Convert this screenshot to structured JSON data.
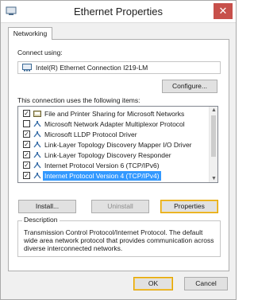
{
  "window": {
    "title": "Ethernet Properties",
    "close_glyph": "✕"
  },
  "tabs": [
    {
      "label": "Networking"
    }
  ],
  "connect_using": {
    "label": "Connect using:",
    "adapter": "Intel(R) Ethernet Connection I219-LM",
    "configure_label": "Configure..."
  },
  "items_section": {
    "label": "This connection uses the following items:",
    "items": [
      {
        "label": "File and Printer Sharing for Microsoft Networks",
        "checked": true,
        "icon": "service-icon"
      },
      {
        "label": "Microsoft Network Adapter Multiplexor Protocol",
        "checked": false,
        "icon": "protocol-icon"
      },
      {
        "label": "Microsoft LLDP Protocol Driver",
        "checked": true,
        "icon": "protocol-icon"
      },
      {
        "label": "Link-Layer Topology Discovery Mapper I/O Driver",
        "checked": true,
        "icon": "protocol-icon"
      },
      {
        "label": "Link-Layer Topology Discovery Responder",
        "checked": true,
        "icon": "protocol-icon"
      },
      {
        "label": "Internet Protocol Version 6 (TCP/IPv6)",
        "checked": true,
        "icon": "protocol-icon"
      },
      {
        "label": "Internet Protocol Version 4 (TCP/IPv4)",
        "checked": true,
        "icon": "protocol-icon",
        "selected": true
      }
    ]
  },
  "item_buttons": {
    "install": "Install...",
    "uninstall": "Uninstall",
    "properties": "Properties"
  },
  "description": {
    "legend": "Description",
    "text": "Transmission Control Protocol/Internet Protocol. The default wide area network protocol that provides communication across diverse interconnected networks."
  },
  "footer": {
    "ok": "OK",
    "cancel": "Cancel"
  },
  "colors": {
    "selection": "#3399ff",
    "default_button_border": "#e2a400",
    "close_button": "#c7504b"
  }
}
